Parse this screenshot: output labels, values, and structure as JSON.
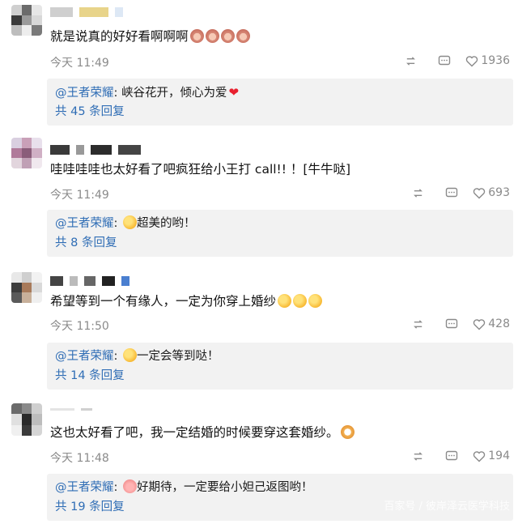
{
  "comments": [
    {
      "text": "就是说真的好好看啊啊啊",
      "emojis": [
        "monkey-face",
        "monkey-face",
        "monkey-face",
        "monkey-face"
      ],
      "time": "今天 11:49",
      "likes": "1936",
      "reply_author": "@王者荣耀",
      "reply_sep": ": ",
      "reply_text": "峡谷花开，倾心为爱",
      "reply_emoji": "heart",
      "reply_count": "共 45 条回复"
    },
    {
      "text": "哇哇哇哇也太好看了吧疯狂给小王打 call!!  ！[牛牛哒]",
      "emojis": [],
      "time": "今天 11:49",
      "likes": "693",
      "reply_author": "@王者荣耀",
      "reply_sep": ": ",
      "reply_emoji": "kiss-face",
      "reply_text": "超美的哟！",
      "reply_count": "共 8 条回复"
    },
    {
      "text": "希望等到一个有缘人，一定为你穿上婚纱",
      "emojis": [
        "kiss-face",
        "kiss-face",
        "kiss-face"
      ],
      "time": "今天 11:50",
      "likes": "428",
      "reply_author": "@王者荣耀",
      "reply_sep": ": ",
      "reply_emoji": "kiss-face",
      "reply_text": "一定会等到哒！",
      "reply_count": "共 14 条回复"
    },
    {
      "text": "这也太好看了吧，我一定结婚的时候要穿这套婚纱。",
      "emojis": [
        "cat-face"
      ],
      "time": "今天 11:48",
      "likes": "194",
      "reply_author": "@王者荣耀",
      "reply_sep": ": ",
      "reply_emoji": "pig-face",
      "reply_text": "好期待，一定要给小妲己返图哟！",
      "reply_count": "共 19 条回复"
    }
  ],
  "watermark": "百家号 / 彼岸泽云医学科技",
  "colors": {
    "link": "#2f6db5",
    "meta": "#8a8a8a",
    "reply_bg": "#f2f2f2",
    "heart": "#e8202e"
  }
}
